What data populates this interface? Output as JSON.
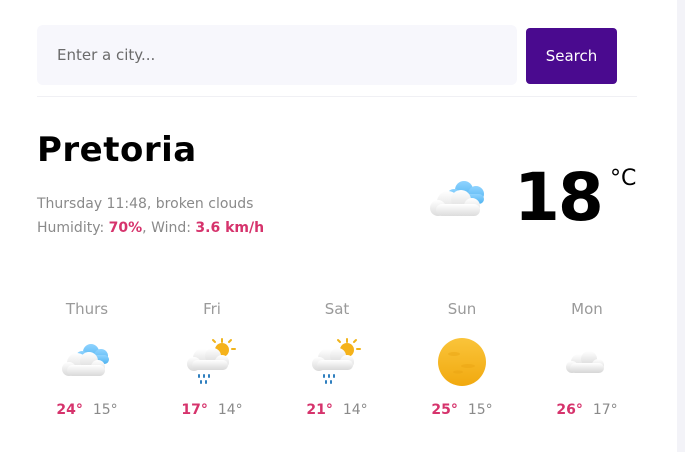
{
  "search": {
    "placeholder": "Enter a city...",
    "button_label": "Search"
  },
  "current": {
    "city": "Pretoria",
    "datetime_desc": "Thursday 11:48, broken clouds",
    "humidity_label": "Humidity: ",
    "humidity_value": "70%",
    "separator": ", ",
    "wind_label": "Wind: ",
    "wind_value": "3.6 km/h",
    "temperature": "18",
    "unit": "°C",
    "icon": "broken-clouds-icon"
  },
  "forecast": [
    {
      "day": "Thurs",
      "max": "24°",
      "min": "15°",
      "icon": "broken-clouds-icon"
    },
    {
      "day": "Fri",
      "max": "17°",
      "min": "14°",
      "icon": "rain-sun-cloud-icon"
    },
    {
      "day": "Sat",
      "max": "21°",
      "min": "14°",
      "icon": "rain-sun-cloud-icon"
    },
    {
      "day": "Sun",
      "max": "25°",
      "min": "15°",
      "icon": "sun-icon"
    },
    {
      "day": "Mon",
      "max": "26°",
      "min": "17°",
      "icon": "cloud-icon"
    }
  ],
  "colors": {
    "accent": "#4a0a8f",
    "highlight": "#d6336c",
    "muted": "#8a8a8a"
  }
}
